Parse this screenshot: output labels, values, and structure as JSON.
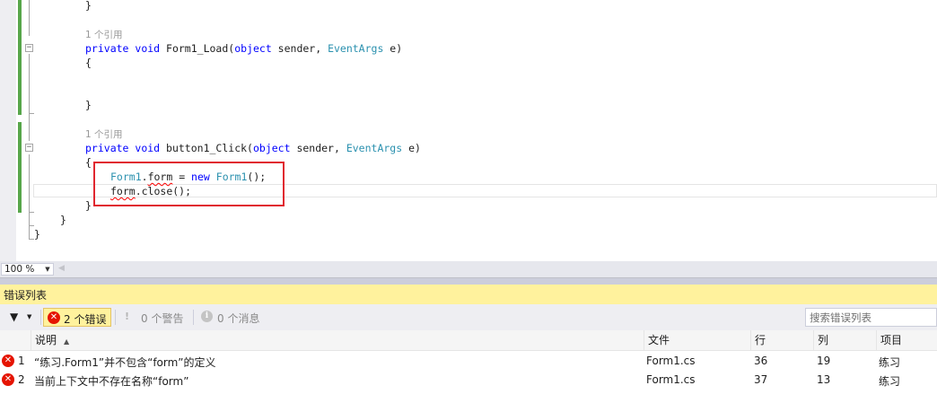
{
  "editor": {
    "lines": [
      {
        "id": "close-brace-1",
        "parts": [
          {
            "t": "}",
            "c": "pl"
          }
        ]
      },
      {
        "id": "codelens-1",
        "codelens": "1 个引用"
      },
      {
        "id": "form1-load-signature",
        "parts": [
          {
            "t": "private",
            "c": "kw"
          },
          {
            "t": " ",
            "c": "pl"
          },
          {
            "t": "void",
            "c": "kw"
          },
          {
            "t": " Form1_Load(",
            "c": "pl"
          },
          {
            "t": "object",
            "c": "kw"
          },
          {
            "t": " sender, ",
            "c": "pl"
          },
          {
            "t": "EventArgs",
            "c": "ty"
          },
          {
            "t": " e)",
            "c": "pl"
          }
        ]
      },
      {
        "id": "open-brace-1",
        "parts": [
          {
            "t": "{",
            "c": "pl"
          }
        ]
      },
      {
        "id": "close-brace-2",
        "parts": [
          {
            "t": "}",
            "c": "pl"
          }
        ]
      },
      {
        "id": "codelens-2",
        "codelens": "1 个引用"
      },
      {
        "id": "button1-click-signature",
        "parts": [
          {
            "t": "private",
            "c": "kw"
          },
          {
            "t": " ",
            "c": "pl"
          },
          {
            "t": "void",
            "c": "kw"
          },
          {
            "t": " button1_Click(",
            "c": "pl"
          },
          {
            "t": "object",
            "c": "kw"
          },
          {
            "t": " sender, ",
            "c": "pl"
          },
          {
            "t": "EventArgs",
            "c": "ty"
          },
          {
            "t": " e)",
            "c": "pl"
          }
        ]
      },
      {
        "id": "open-brace-2",
        "parts": [
          {
            "t": "{",
            "c": "pl"
          }
        ]
      },
      {
        "id": "form-assign-line",
        "parts": [
          {
            "t": "Form1",
            "c": "ty"
          },
          {
            "t": ".",
            "c": "pl"
          },
          {
            "t": "form",
            "c": "pl",
            "err": true
          },
          {
            "t": " = ",
            "c": "pl"
          },
          {
            "t": "new",
            "c": "kw"
          },
          {
            "t": " ",
            "c": "pl"
          },
          {
            "t": "Form1",
            "c": "ty"
          },
          {
            "t": "();",
            "c": "pl"
          }
        ]
      },
      {
        "id": "form-close-line",
        "parts": [
          {
            "t": "form",
            "c": "pl",
            "err": true
          },
          {
            "t": ".close();",
            "c": "pl"
          }
        ]
      },
      {
        "id": "close-brace-3",
        "parts": [
          {
            "t": "}",
            "c": "pl"
          }
        ]
      },
      {
        "id": "close-brace-class",
        "parts": [
          {
            "t": "}",
            "c": "pl"
          }
        ]
      },
      {
        "id": "close-brace-namespace",
        "parts": [
          {
            "t": "}",
            "c": "pl"
          }
        ]
      }
    ],
    "zoom": "100 %"
  },
  "error_list": {
    "title": "错误列表",
    "errors_label": "2 个错误",
    "warnings_label": "0 个警告",
    "messages_label": "0 个消息",
    "search_placeholder": "搜索错误列表",
    "columns": {
      "description": "说明",
      "file": "文件",
      "line": "行",
      "column": "列",
      "project": "项目"
    },
    "rows": [
      {
        "index": "1",
        "description": "“练习.Form1”并不包含“form”的定义",
        "file": "Form1.cs",
        "line": "36",
        "column": "19",
        "project": "练习"
      },
      {
        "index": "2",
        "description": "当前上下文中不存在名称“form”",
        "file": "Form1.cs",
        "line": "37",
        "column": "13",
        "project": "练习"
      }
    ]
  },
  "colors": {
    "keyword": "#0000ff",
    "type": "#2b91af",
    "codelens": "#999999",
    "change_bar": "#57a64a",
    "error": "#e51400",
    "highlight_box": "#e0262f",
    "error_list_title_bg": "#fff29d"
  },
  "icons": {
    "filter": "filter-icon",
    "error": "error-icon",
    "warning": "warning-icon",
    "message": "info-icon",
    "sort": "sort-ascending-icon"
  }
}
